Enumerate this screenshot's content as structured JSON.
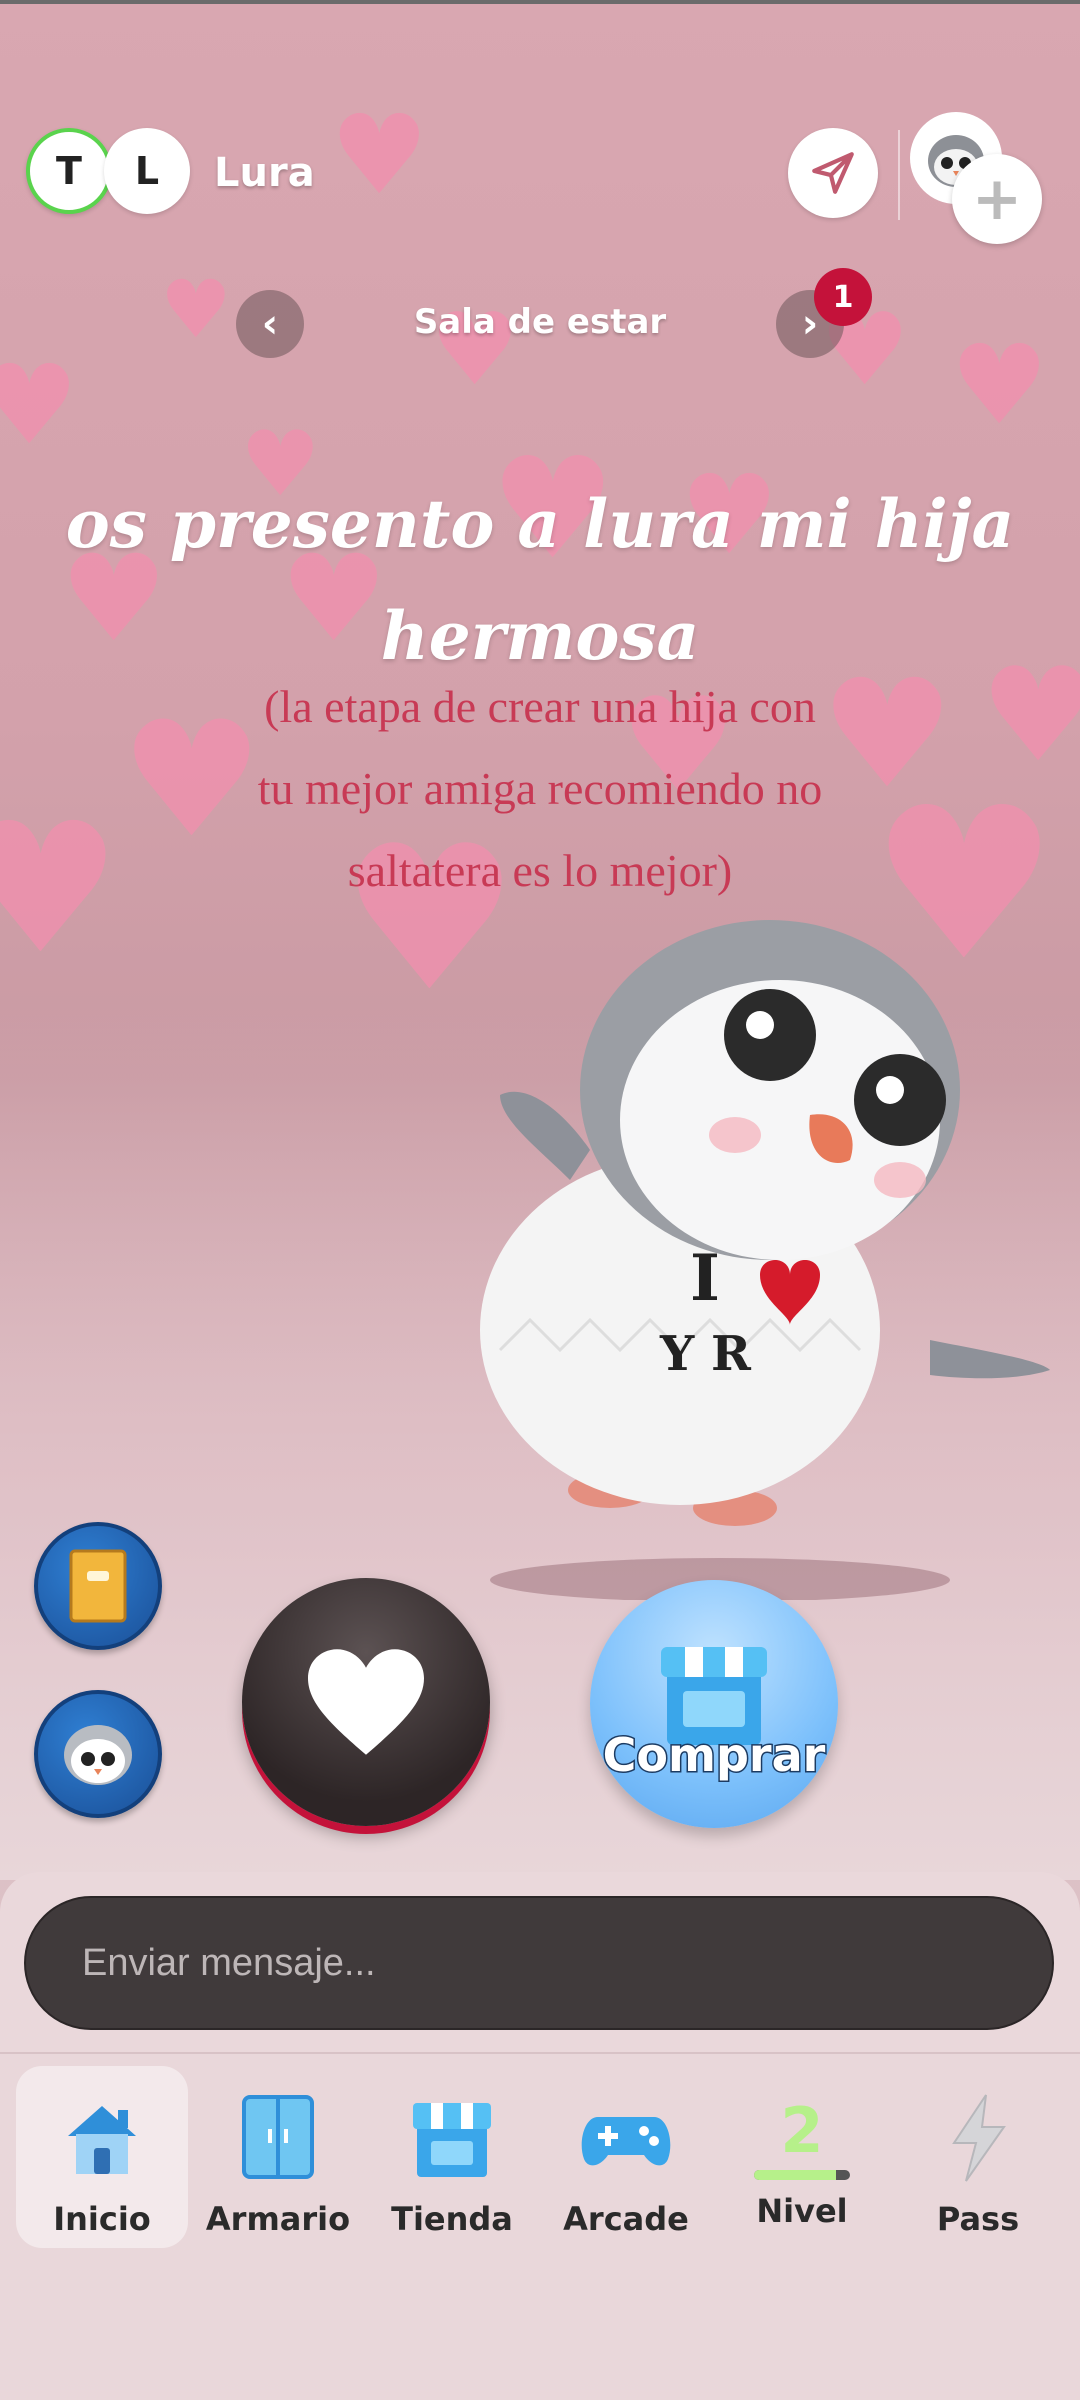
{
  "header": {
    "avatars": [
      "T",
      "L"
    ],
    "pet_name": "Lura",
    "icons": {
      "send": "send-icon",
      "add_friend": "plus-icon"
    }
  },
  "room": {
    "title": "Sala de estar",
    "badge_count": "1"
  },
  "wall": {
    "title_line1": "os presento a lura mi hija",
    "title_line2": "hermosa",
    "subtitle_line1": "(la etapa de crear una hija con",
    "subtitle_line2": "tu mejor amiga recomiendo no",
    "subtitle_line3": "saltatera es lo mejor)"
  },
  "actions": {
    "buy_label": "Comprar",
    "side_buttons": [
      "book-icon",
      "penguin-icon"
    ]
  },
  "message": {
    "placeholder": "Enviar mensaje..."
  },
  "nav": {
    "items": [
      {
        "label": "Inicio",
        "icon": "home-icon",
        "active": true
      },
      {
        "label": "Armario",
        "icon": "wardrobe-icon",
        "active": false
      },
      {
        "label": "Tienda",
        "icon": "shop-icon",
        "active": false
      },
      {
        "label": "Arcade",
        "icon": "gamepad-icon",
        "active": false
      },
      {
        "label": "Nivel",
        "icon": "level-icon",
        "active": false,
        "level": "2",
        "progress": 0.85
      },
      {
        "label": "Pass",
        "icon": "lightning-icon",
        "active": false
      }
    ]
  },
  "colors": {
    "background": "#d9a7b1",
    "badge": "#c4123a",
    "wall_subtitle": "#c83a55",
    "message_bar": "#403a3b",
    "level_green": "#b6f08a"
  }
}
